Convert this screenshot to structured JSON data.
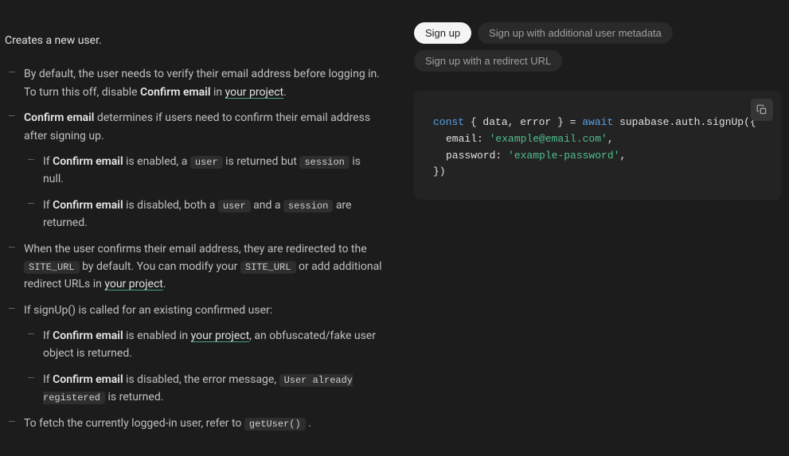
{
  "intro": "Creates a new user.",
  "bullets": {
    "b1_pre": "By default, the user needs to verify their email address before logging in. To turn this off, disable ",
    "confirm_email": "Confirm email",
    "b1_mid": " in ",
    "your_project": "your project",
    "period": ".",
    "b2_mid": " determines if users need to confirm their email address after signing up.",
    "b2a_pre": "If ",
    "b2a_mid1": " is enabled, a ",
    "user_code": "user",
    "b2a_mid2": " is returned but ",
    "session_code": "session",
    "b2a_end": " is null.",
    "b2b_mid1": " is disabled, both a ",
    "b2b_mid2": " and a ",
    "b2b_end": " are returned.",
    "b3_pre": "When the user confirms their email address, they are redirected to the ",
    "site_url_code": "SITE_URL",
    "b3_mid1": " by default. You can modify your ",
    "b3_mid2": " or add additional redirect URLs in ",
    "b4": "If signUp() is called for an existing confirmed user:",
    "b4a_mid": " is enabled in ",
    "b4a_end": ", an obfuscated/fake user object is returned.",
    "b4b_mid": " is disabled, the error message, ",
    "user_already_code": "User already registered",
    "b4b_end": " is returned.",
    "b5_pre": "To fetch the currently logged-in user, refer to ",
    "getuser_code": "getUser()",
    "b5_end": " ."
  },
  "tabs": {
    "t1": "Sign up",
    "t2": "Sign up with additional user metadata",
    "t3": "Sign up with a redirect URL"
  },
  "code": {
    "const": "const",
    "destructure": " { data, error } = ",
    "await": "await",
    "call": " supabase.auth.signUp({",
    "email_key": "email: ",
    "email_val": "'example@email.com'",
    "comma": ",",
    "password_key": "password: ",
    "password_val": "'example-password'",
    "close": "})"
  }
}
